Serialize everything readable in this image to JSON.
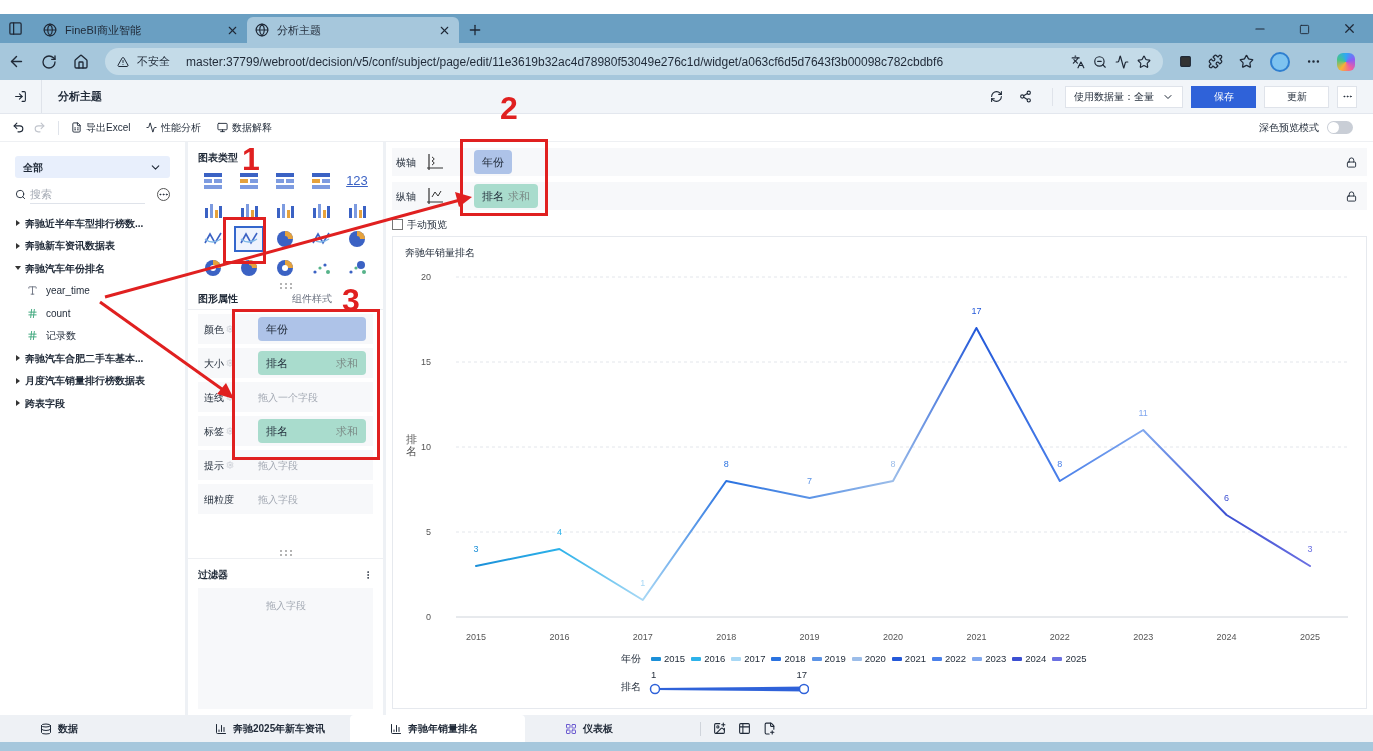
{
  "browser": {
    "tabs": [
      {
        "title": "FineBI商业智能",
        "selected": false
      },
      {
        "title": "分析主题",
        "selected": true
      }
    ],
    "security": "不安全",
    "url": "master:37799/webroot/decision/v5/conf/subject/page/edit/11e3619b32ac4d78980f53049e276c1d/widget/a063cf6d5d7643f3b00098c782cbdbf6"
  },
  "header": {
    "title": "分析主题",
    "data_amount": "使用数据量：全量",
    "save": "保存",
    "update": "更新"
  },
  "toolbar": {
    "items": [
      "导出Excel",
      "性能分析",
      "数据解释"
    ],
    "dark_preview": {
      "label": "深色预览模式",
      "on": false
    }
  },
  "data_panel": {
    "scope": "全部",
    "search_placeholder": "搜索",
    "tree": [
      {
        "label": "奔驰近半年车型排行榜数...",
        "expanded": false
      },
      {
        "label": "奔驰新车资讯数据表",
        "expanded": false
      },
      {
        "label": "奔驰汽车年份排名",
        "expanded": true,
        "children": [
          {
            "label": "year_time",
            "kind": "text"
          },
          {
            "label": "count",
            "kind": "number"
          },
          {
            "label": "记录数",
            "kind": "count"
          }
        ]
      },
      {
        "label": "奔驰汽车合肥二手车基本...",
        "expanded": false
      },
      {
        "label": "月度汽车销量排行榜数据表",
        "expanded": false
      },
      {
        "label": "跨表字段",
        "expanded": false
      }
    ]
  },
  "chart_panel": {
    "title": "图表类型",
    "types": [
      {
        "kind": "table",
        "selected": false
      },
      {
        "kind": "table",
        "selected": false
      },
      {
        "kind": "table",
        "selected": false
      },
      {
        "kind": "table",
        "selected": false
      },
      {
        "kind": "number",
        "label": "123",
        "selected": false
      },
      {
        "kind": "bar",
        "selected": false
      },
      {
        "kind": "bar",
        "selected": false
      },
      {
        "kind": "bar",
        "selected": false
      },
      {
        "kind": "bar",
        "selected": false
      },
      {
        "kind": "bar",
        "selected": false
      },
      {
        "kind": "line",
        "selected": false
      },
      {
        "kind": "line",
        "selected": true
      },
      {
        "kind": "pie",
        "selected": false
      },
      {
        "kind": "line",
        "selected": false
      },
      {
        "kind": "pie",
        "selected": false
      },
      {
        "kind": "pie",
        "selected": false
      },
      {
        "kind": "pie",
        "selected": false
      },
      {
        "kind": "pie",
        "selected": false
      },
      {
        "kind": "scatter",
        "selected": false
      },
      {
        "kind": "scatter",
        "selected": false
      }
    ],
    "tabs": [
      {
        "label": "图形属性",
        "selected": true
      },
      {
        "label": "组件样式",
        "selected": false
      }
    ],
    "properties": [
      {
        "label": "颜色",
        "settings": true,
        "field": {
          "name": "年份",
          "kind": "dimension"
        }
      },
      {
        "label": "大小",
        "settings": true,
        "field": {
          "name": "排名",
          "aggregate": "求和",
          "kind": "measure"
        }
      },
      {
        "label": "连线",
        "settings": true,
        "placeholder": "拖入一个字段"
      },
      {
        "label": "标签",
        "settings": true,
        "field": {
          "name": "排名",
          "aggregate": "求和",
          "kind": "measure"
        }
      },
      {
        "label": "提示",
        "settings": true,
        "placeholder": "拖入字段"
      },
      {
        "label": "细粒度",
        "settings": false,
        "placeholder": "拖入字段"
      }
    ],
    "filter": {
      "title": "过滤器",
      "placeholder": "拖入字段"
    }
  },
  "axes": [
    {
      "label": "横轴",
      "field": {
        "name": "年份",
        "kind": "dimension"
      }
    },
    {
      "label": "纵轴",
      "field": {
        "name": "排名",
        "aggregate": "求和",
        "kind": "measure"
      }
    }
  ],
  "manual_preview": {
    "label": "手动预览",
    "checked": false
  },
  "chart": {
    "chart_data": {
      "type": "line",
      "title": "奔驰年销量排名",
      "ylabel": "排名",
      "categories": [
        "2015",
        "2016",
        "2017",
        "2018",
        "2019",
        "2020",
        "2021",
        "2022",
        "2023",
        "2024",
        "2025"
      ],
      "series": [
        {
          "values": [
            3,
            4,
            1,
            8,
            7,
            8,
            17,
            8,
            11,
            6,
            3
          ]
        }
      ],
      "ylim": [
        0,
        20
      ],
      "yticks": [
        0,
        5,
        10,
        15,
        20
      ],
      "grid": true,
      "data_labels": true
    },
    "legend": {
      "title": "年份",
      "items": [
        {
          "label": "2015",
          "color": "#1b8fd8"
        },
        {
          "label": "2016",
          "color": "#2cb2ea"
        },
        {
          "label": "2017",
          "color": "#a8d8f5"
        },
        {
          "label": "2018",
          "color": "#2a72e0"
        },
        {
          "label": "2019",
          "color": "#5b93e6"
        },
        {
          "label": "2020",
          "color": "#9cbde9"
        },
        {
          "label": "2021",
          "color": "#2459d9"
        },
        {
          "label": "2022",
          "color": "#4a80ea"
        },
        {
          "label": "2023",
          "color": "#80a7ee"
        },
        {
          "label": "2024",
          "color": "#3b4fd2"
        },
        {
          "label": "2025",
          "color": "#6b70e2"
        }
      ]
    },
    "size_legend": {
      "title": "排名",
      "min": "1",
      "max": "17",
      "level": 1
    }
  },
  "bottom_tabs": [
    {
      "label": "数据",
      "kind": "data",
      "selected": false
    },
    {
      "label": "奔驰2025年新车资讯",
      "kind": "component",
      "selected": false
    },
    {
      "label": "奔驰年销量排名",
      "kind": "component",
      "selected": true
    },
    {
      "label": "仪表板",
      "kind": "dashboard",
      "selected": false
    }
  ],
  "annotations": [
    {
      "label": "1"
    },
    {
      "label": "2"
    },
    {
      "label": "3"
    }
  ]
}
